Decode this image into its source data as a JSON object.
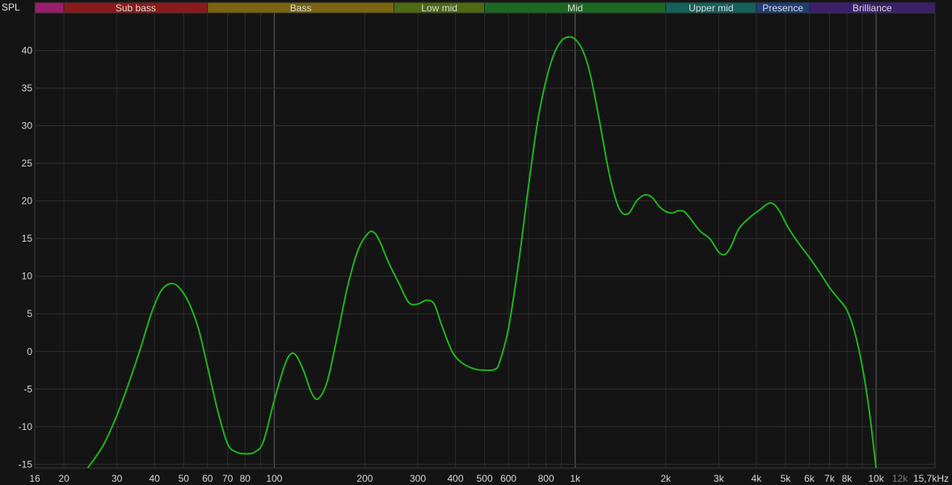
{
  "chart_data": {
    "type": "line",
    "ylabel": "SPL",
    "xscale": "log",
    "xlim": [
      16,
      15700
    ],
    "ylim": [
      -15.5,
      45
    ],
    "grid": true,
    "y_ticks": [
      -15,
      -10,
      -5,
      0,
      5,
      10,
      15,
      20,
      25,
      30,
      35,
      40
    ],
    "x_ticks": [
      {
        "value": 16,
        "label": "16"
      },
      {
        "value": 20,
        "label": "20"
      },
      {
        "value": 30,
        "label": "30"
      },
      {
        "value": 40,
        "label": "40"
      },
      {
        "value": 50,
        "label": "50"
      },
      {
        "value": 60,
        "label": "60"
      },
      {
        "value": 70,
        "label": "70"
      },
      {
        "value": 80,
        "label": "80"
      },
      {
        "value": 100,
        "label": "100"
      },
      {
        "value": 200,
        "label": "200"
      },
      {
        "value": 300,
        "label": "300"
      },
      {
        "value": 400,
        "label": "400"
      },
      {
        "value": 500,
        "label": "500"
      },
      {
        "value": 600,
        "label": "600"
      },
      {
        "value": 800,
        "label": "800"
      },
      {
        "value": 1000,
        "label": "1k"
      },
      {
        "value": 2000,
        "label": "2k"
      },
      {
        "value": 3000,
        "label": "3k"
      },
      {
        "value": 4000,
        "label": "4k"
      },
      {
        "value": 5000,
        "label": "5k"
      },
      {
        "value": 6000,
        "label": "6k"
      },
      {
        "value": 7000,
        "label": "7k"
      },
      {
        "value": 8000,
        "label": "8k"
      },
      {
        "value": 10000,
        "label": "10k"
      },
      {
        "value": 12000,
        "label": "12k",
        "dim": true
      },
      {
        "value": 15700,
        "label": "15,7kHz"
      }
    ],
    "bands": [
      {
        "name": "",
        "from": 16,
        "to": 20,
        "color": "#9a1e6e"
      },
      {
        "name": "Sub bass",
        "from": 20,
        "to": 60,
        "color": "#8c1a1a"
      },
      {
        "name": "Bass",
        "from": 60,
        "to": 250,
        "color": "#7a6410"
      },
      {
        "name": "Low mid",
        "from": 250,
        "to": 500,
        "color": "#4e6a12"
      },
      {
        "name": "Mid",
        "from": 500,
        "to": 2000,
        "color": "#1c6a22"
      },
      {
        "name": "Upper mid",
        "from": 2000,
        "to": 4000,
        "color": "#15615c"
      },
      {
        "name": "Presence",
        "from": 4000,
        "to": 6000,
        "color": "#1e3e76"
      },
      {
        "name": "Brilliance",
        "from": 6000,
        "to": 15700,
        "color": "#3c1e6a"
      }
    ],
    "series": [
      {
        "color": "#1fb21f",
        "x": [
          24,
          27,
          30,
          33,
          36,
          39,
          42,
          45,
          48,
          52,
          56,
          60,
          65,
          70,
          75,
          80,
          86,
          92,
          100,
          108,
          113,
          118,
          125,
          133,
          140,
          150,
          162,
          175,
          190,
          205,
          215,
          225,
          240,
          260,
          280,
          300,
          320,
          340,
          360,
          390,
          420,
          460,
          500,
          540,
          560,
          600,
          650,
          700,
          750,
          800,
          850,
          900,
          950,
          1000,
          1060,
          1120,
          1200,
          1300,
          1400,
          1500,
          1600,
          1700,
          1800,
          1900,
          2000,
          2100,
          2200,
          2300,
          2400,
          2600,
          2800,
          3000,
          3150,
          3300,
          3500,
          3800,
          4100,
          4400,
          4600,
          4800,
          5100,
          5500,
          6000,
          6500,
          7000,
          7500,
          8000,
          8500,
          9000,
          9500,
          10000
        ],
        "y": [
          -15.5,
          -12.5,
          -8.5,
          -4,
          0.5,
          5,
          8,
          9,
          8.6,
          6.5,
          3,
          -2,
          -8,
          -12.3,
          -13.4,
          -13.6,
          -13.4,
          -12,
          -6.5,
          -2,
          -0.4,
          -0.5,
          -2.5,
          -5.5,
          -6.3,
          -4,
          2,
          8.5,
          13.5,
          15.7,
          15.8,
          14.5,
          11.8,
          9,
          6.5,
          6.3,
          6.8,
          6.3,
          3.5,
          0,
          -1.5,
          -2.3,
          -2.5,
          -2.4,
          -1.5,
          3,
          12,
          22,
          30.5,
          36,
          39.5,
          41.3,
          41.8,
          41.5,
          40,
          37,
          31,
          23.5,
          19,
          18.3,
          20,
          20.8,
          20.5,
          19.3,
          18.6,
          18.4,
          18.7,
          18.6,
          17.8,
          16,
          15,
          13.2,
          12.9,
          14,
          16.3,
          17.8,
          18.8,
          19.7,
          19.5,
          18.5,
          16.5,
          14.5,
          12.5,
          10.5,
          8.5,
          7,
          5.5,
          2.5,
          -2,
          -8,
          -15.5
        ]
      }
    ]
  }
}
